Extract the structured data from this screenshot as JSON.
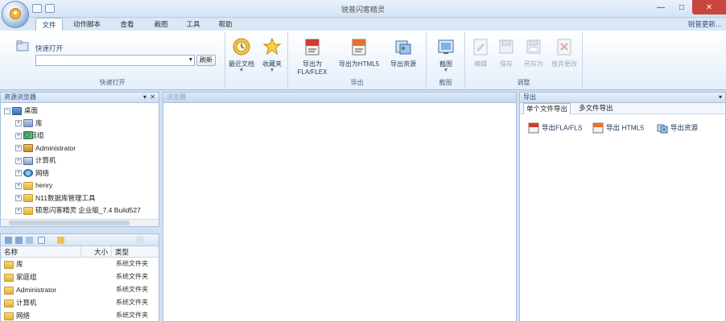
{
  "window": {
    "title": "锐普闪客精灵"
  },
  "tabs": [
    {
      "label": "文件",
      "active": true
    },
    {
      "label": "动作脚本",
      "active": false
    },
    {
      "label": "查看",
      "active": false
    },
    {
      "label": "截图",
      "active": false
    },
    {
      "label": "工具",
      "active": false
    },
    {
      "label": "帮助",
      "active": false
    }
  ],
  "theme_link": "锐普更新...",
  "ribbon": {
    "quick_open": {
      "label": "快速打开",
      "path_value": "",
      "refresh_label": "刷新",
      "group_label": "快速打开"
    },
    "recent_label": "最近文档",
    "favorites_label": "收藏夹",
    "export": {
      "to_fla": "导出为FLA/FLEX",
      "to_html5": "导出为HTML5",
      "resources": "导出资源",
      "group_label": "导出"
    },
    "capture": {
      "label": "截图",
      "group_label": "截图"
    },
    "edit": {
      "edit": "编辑",
      "save": "保存",
      "save_as": "另存为",
      "discard": "放弃更改",
      "group_label": "调整"
    }
  },
  "resource_browser": {
    "title": "资源浏览器",
    "tree": [
      {
        "label": "桌面",
        "icon": "desktop",
        "level": 0,
        "expander": "−"
      },
      {
        "label": "库",
        "icon": "lib",
        "level": 1,
        "expander": "+"
      },
      {
        "label": "家庭组",
        "icon": "group",
        "level": 1,
        "expander": "+"
      },
      {
        "label": "Administrator",
        "icon": "user",
        "level": 1,
        "expander": "+"
      },
      {
        "label": "计算机",
        "icon": "pc",
        "level": 1,
        "expander": "+"
      },
      {
        "label": "网络",
        "icon": "net",
        "level": 1,
        "expander": "+"
      },
      {
        "label": "henry",
        "icon": "folder",
        "level": 1,
        "expander": "+"
      },
      {
        "label": "N11数据库管理工具",
        "icon": "folder",
        "level": 1,
        "expander": "+"
      },
      {
        "label": "硕思闪客精灵 企业版_7.4 Build527",
        "icon": "folder",
        "level": 1,
        "expander": "+"
      }
    ]
  },
  "file_list": {
    "columns": {
      "name": "名称",
      "size": "大小",
      "type": "类型"
    },
    "rows": [
      {
        "name": "库",
        "type": "系统文件夹"
      },
      {
        "name": "家庭组",
        "type": "系统文件夹"
      },
      {
        "name": "Administrator",
        "type": "系统文件夹"
      },
      {
        "name": "计算机",
        "type": "系统文件夹"
      },
      {
        "name": "网络",
        "type": "系统文件夹"
      }
    ]
  },
  "preview": {
    "title": "浏览器"
  },
  "export_panel": {
    "title": "导出",
    "tabs": [
      {
        "label": "单个文件导出",
        "active": true
      },
      {
        "label": "多文件导出",
        "active": false
      }
    ],
    "actions": {
      "to_fla": "导出FLA/FLS",
      "to_html5": "导出 HTML5",
      "resources": "导出资源"
    }
  }
}
